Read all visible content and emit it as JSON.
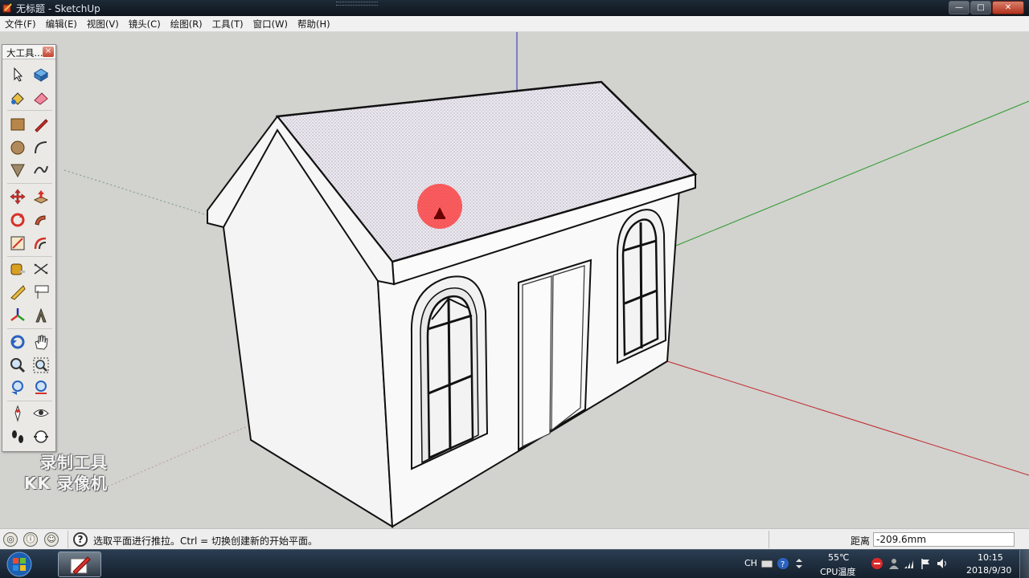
{
  "window": {
    "title": "无标题 - SketchUp",
    "buttons": {
      "minimize": "—",
      "maximize": "□",
      "close": "✕"
    }
  },
  "menubar": {
    "items": [
      "文件(F)",
      "编辑(E)",
      "视图(V)",
      "镜头(C)",
      "绘图(R)",
      "工具(T)",
      "窗口(W)",
      "帮助(H)"
    ]
  },
  "toolset": {
    "title": "大工具...",
    "close": "×",
    "tools": [
      "select-tool",
      "make-component-tool",
      "paint-bucket-tool",
      "eraser-tool",
      "rectangle-tool",
      "line-tool",
      "circle-tool",
      "arc-tool",
      "polygon-tool",
      "freehand-tool",
      "move-tool",
      "push-pull-tool",
      "rotate-tool",
      "follow-me-tool",
      "scale-tool",
      "offset-tool",
      "tape-measure-tool",
      "dimension-tool",
      "protractor-tool",
      "text-tool",
      "axes-tool",
      "3d-text-tool",
      "orbit-tool",
      "pan-tool",
      "zoom-tool",
      "zoom-window-tool",
      "previous-view-tool",
      "zoom-extents-tool",
      "position-camera-tool",
      "look-around-tool",
      "walk-tool",
      "section-plane-tool"
    ]
  },
  "watermark": {
    "line1": "录制工具",
    "line2": "KK 录像机"
  },
  "statusbar": {
    "message": "选取平面进行推拉。Ctrl = 切换创建新的开始平面。",
    "help_glyph": "?",
    "measurement_label": "距离",
    "measurement_value": "-209.6mm"
  },
  "taskbar": {
    "ime": "CH",
    "cpu_temp": "55℃",
    "cpu_label": "CPU温度",
    "time": "10:15",
    "date": "2018/9/30"
  },
  "colors": {
    "viewport_bg": "#d2d2cf",
    "axis_red": "#c0282a",
    "axis_green": "#2a9a2a",
    "axis_blue": "#2a2ab0",
    "roof": "#ebe8f0",
    "wall": "#f7f7f7",
    "pushpull_highlight": "#ff2d2d"
  }
}
